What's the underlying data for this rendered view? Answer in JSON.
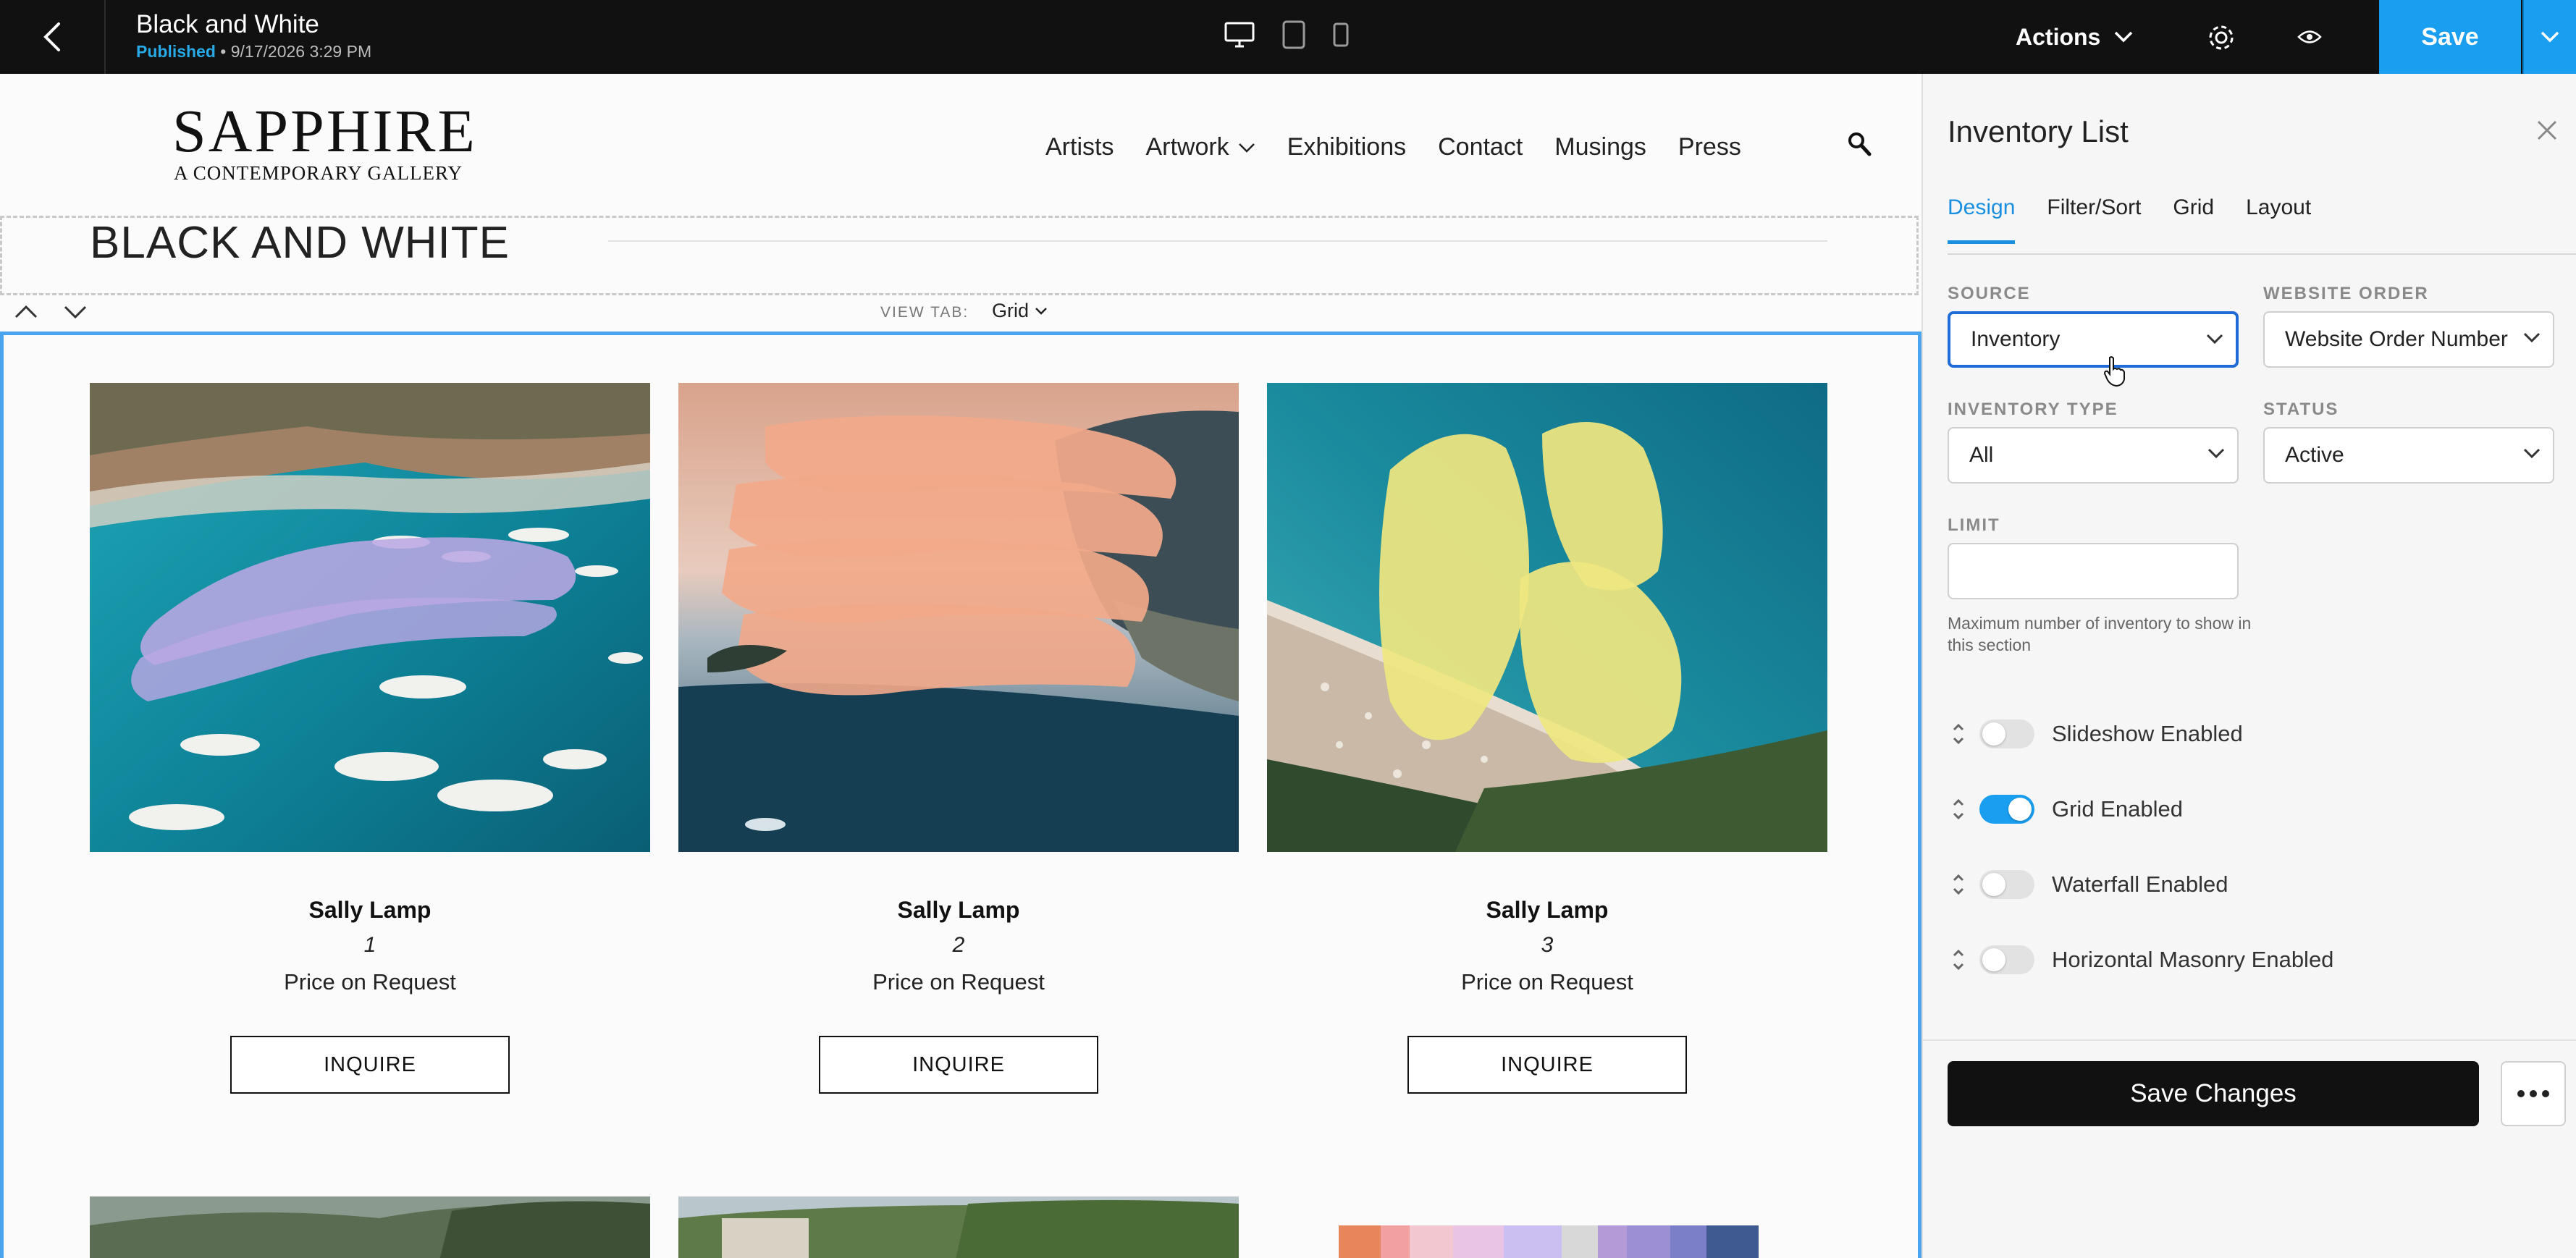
{
  "topbar": {
    "title": "Black and White",
    "status": "Published",
    "separator": "•",
    "date": "9/17/2026 3:29 PM",
    "actions_label": "Actions",
    "save_label": "Save",
    "brand_color": "#1a9ef0"
  },
  "site": {
    "logo": "SAPPHIRE",
    "tagline": "A CONTEMPORARY GALLERY",
    "nav": [
      "Artists",
      "Artwork",
      "Exhibitions",
      "Contact",
      "Musings",
      "Press"
    ],
    "heading": "BLACK AND WHITE",
    "view_tab_label": "VIEW TAB:",
    "view_tab_value": "Grid",
    "cards": [
      {
        "name": "Sally Lamp",
        "number": "1",
        "price": "Price on Request",
        "button": "INQUIRE"
      },
      {
        "name": "Sally Lamp",
        "number": "2",
        "price": "Price on Request",
        "button": "INQUIRE"
      },
      {
        "name": "Sally Lamp",
        "number": "3",
        "price": "Price on Request",
        "button": "INQUIRE"
      }
    ]
  },
  "panel": {
    "title": "Inventory List",
    "tabs": [
      "Design",
      "Filter/Sort",
      "Grid",
      "Layout"
    ],
    "active_tab": "Design",
    "source": {
      "label": "SOURCE",
      "value": "Inventory"
    },
    "website_order": {
      "label": "WEBSITE ORDER",
      "value": "Website Order Number"
    },
    "inventory_type": {
      "label": "INVENTORY TYPE",
      "value": "All"
    },
    "status": {
      "label": "STATUS",
      "value": "Active"
    },
    "limit": {
      "label": "LIMIT",
      "value": "",
      "hint": "Maximum number of inventory to show in this section"
    },
    "toggles": [
      {
        "label": "Slideshow Enabled",
        "on": false
      },
      {
        "label": "Grid Enabled",
        "on": true
      },
      {
        "label": "Waterfall Enabled",
        "on": false
      },
      {
        "label": "Horizontal Masonry Enabled",
        "on": false
      }
    ],
    "save_changes": "Save Changes"
  }
}
